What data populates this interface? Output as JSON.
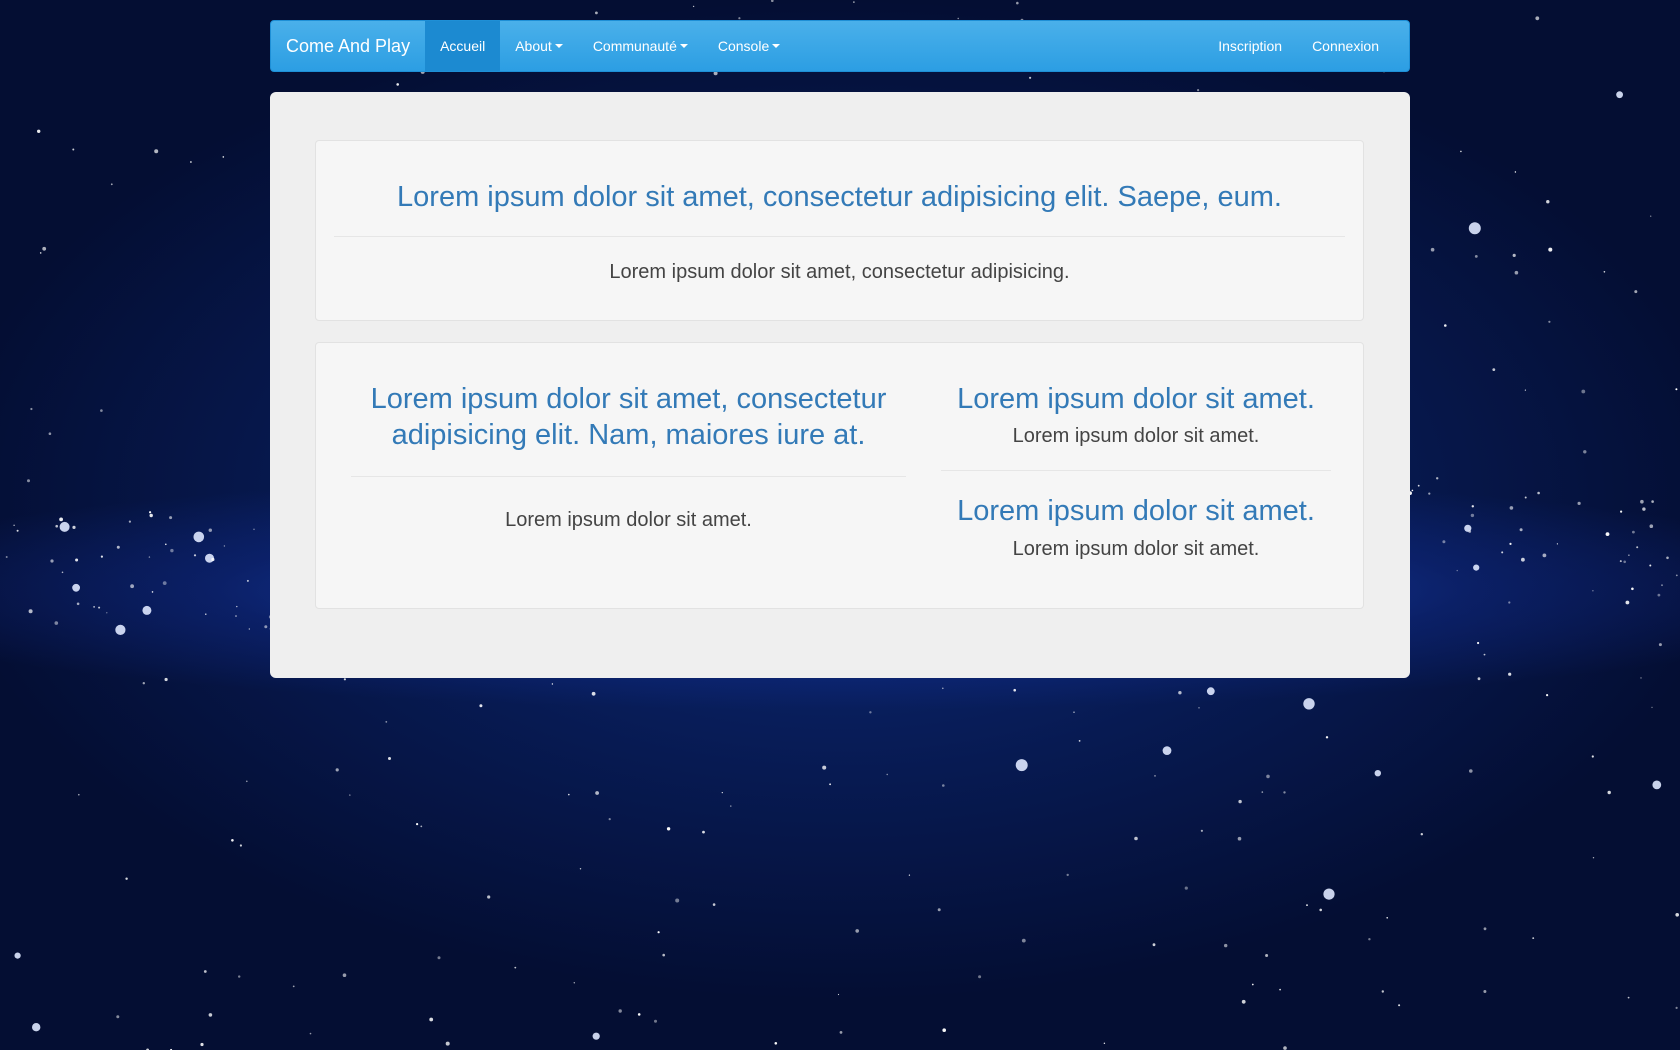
{
  "navbar": {
    "brand": "Come And Play",
    "left_items": [
      {
        "label": "Accueil",
        "active": true,
        "dropdown": false
      },
      {
        "label": "About",
        "active": false,
        "dropdown": true
      },
      {
        "label": "Communauté",
        "active": false,
        "dropdown": true
      },
      {
        "label": "Console",
        "active": false,
        "dropdown": true
      }
    ],
    "right_items": [
      {
        "label": "Inscription"
      },
      {
        "label": "Connexion"
      }
    ],
    "color": "#2c9ee3"
  },
  "hero": {
    "title": "Lorem ipsum dolor sit amet, consectetur adipisicing elit. Saepe, eum.",
    "text": "Lorem ipsum dolor sit amet, consectetur adipisicing."
  },
  "features": {
    "left": {
      "title": "Lorem ipsum dolor sit amet, consectetur adipisicing elit. Nam, maiores iure at.",
      "text": "Lorem ipsum dolor sit amet."
    },
    "right": [
      {
        "title": "Lorem ipsum dolor sit amet.",
        "text": "Lorem ipsum dolor sit amet."
      },
      {
        "title": "Lorem ipsum dolor sit amet.",
        "text": "Lorem ipsum dolor sit amet."
      }
    ]
  },
  "colors": {
    "heading": "#337ab7",
    "body_text": "#444444",
    "panel": "#efefef"
  }
}
